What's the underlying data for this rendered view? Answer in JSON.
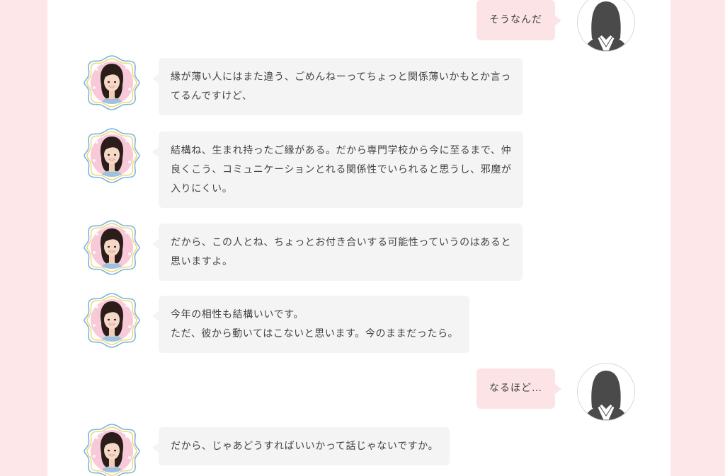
{
  "chat": {
    "messages": [
      {
        "speaker": "user",
        "avatar_icon": "user-silhouette-icon",
        "lines": [
          "そうなんだ"
        ]
      },
      {
        "speaker": "reader",
        "avatar_icon": "reader-portrait-icon",
        "lines": [
          "縁が薄い人にはまた違う、ごめんねーってちょっと関係薄いかもとか言っ",
          "てるんですけど、"
        ]
      },
      {
        "speaker": "reader",
        "avatar_icon": "reader-portrait-icon",
        "lines": [
          "結構ね、生まれ持ったご縁がある。だから専門学校から今に至るまで、仲",
          "良くこう、コミュニケーションとれる関係性でいられると思うし、邪魔が",
          "入りにくい。"
        ]
      },
      {
        "speaker": "reader",
        "avatar_icon": "reader-portrait-icon",
        "lines": [
          "だから、この人とね、ちょっとお付き合いする可能性っていうのはあると",
          "思いますよ。"
        ]
      },
      {
        "speaker": "reader",
        "avatar_icon": "reader-portrait-icon",
        "lines": [
          "今年の相性も結構いいです。",
          "ただ、彼から動いてはこないと思います。今のままだったら。"
        ]
      },
      {
        "speaker": "user",
        "avatar_icon": "user-silhouette-icon",
        "lines": [
          "なるほど…"
        ]
      },
      {
        "speaker": "reader",
        "avatar_icon": "reader-portrait-icon",
        "lines": [
          "だから、じゃあどうすればいいかって話じゃないですか。"
        ]
      }
    ]
  },
  "colors": {
    "page_background": "#fde7e8",
    "panel_background": "#ffffff",
    "reader_bubble": "#f4f4f4",
    "user_bubble": "#fce4e6",
    "text": "#444444",
    "avatar_frame_blue": "#7ab6dc",
    "avatar_frame_yellow": "#f2d36b"
  }
}
